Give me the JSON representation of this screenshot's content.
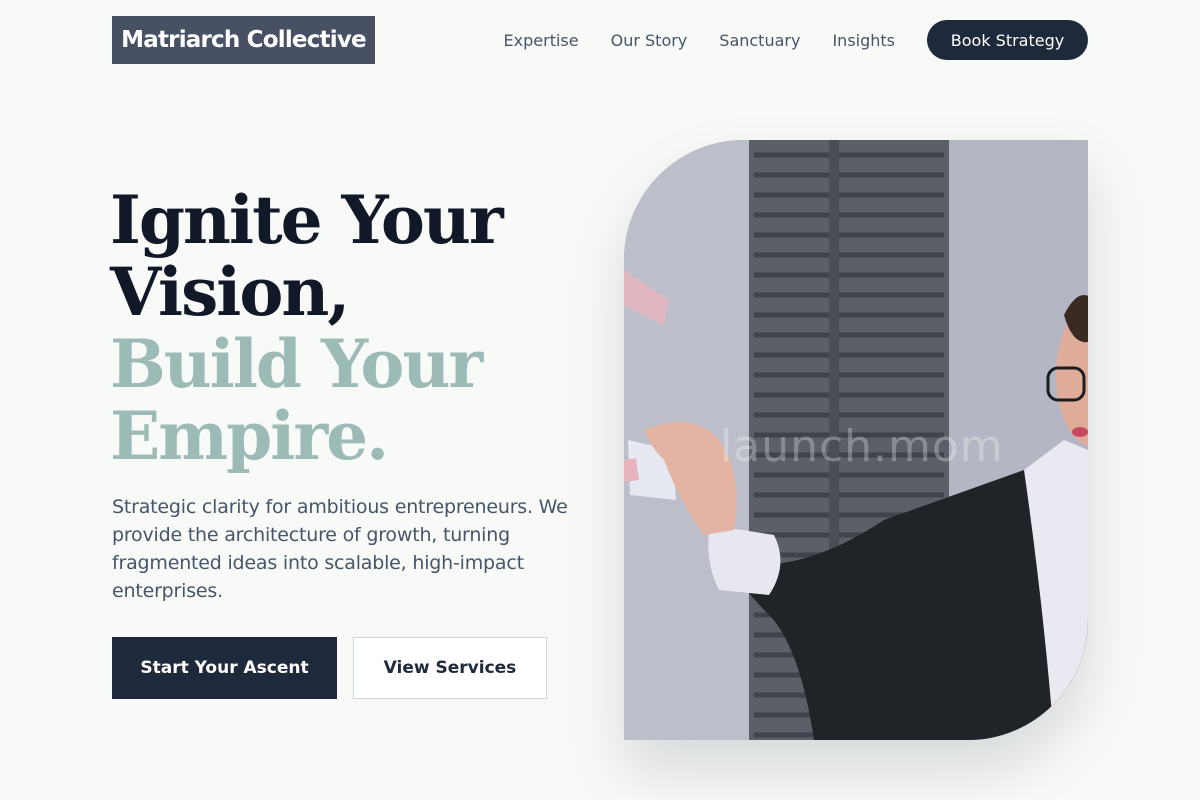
{
  "brand": {
    "name": "Matriarch Collective"
  },
  "nav": {
    "links": [
      "Expertise",
      "Our Story",
      "Sanctuary",
      "Insights"
    ],
    "cta_label": "Book Strategy"
  },
  "hero": {
    "headline_line1": "Ignite Your",
    "headline_line2": "Vision,",
    "headline_line3": "Build Your",
    "headline_line4": "Empire.",
    "description": "Strategic clarity for ambitious entrepreneurs. We provide the architecture of growth, turning fragmented ideas into scalable, high-impact enterprises.",
    "primary_button": "Start Your Ascent",
    "secondary_button": "View Services",
    "image_watermark": "launch.mom"
  },
  "colors": {
    "background": "#f8faf8",
    "logo_bg": "#475163",
    "navy": "#1e293b",
    "headline_dark": "#111827",
    "headline_accent": "#9dbbb6",
    "body_text": "#475569"
  }
}
